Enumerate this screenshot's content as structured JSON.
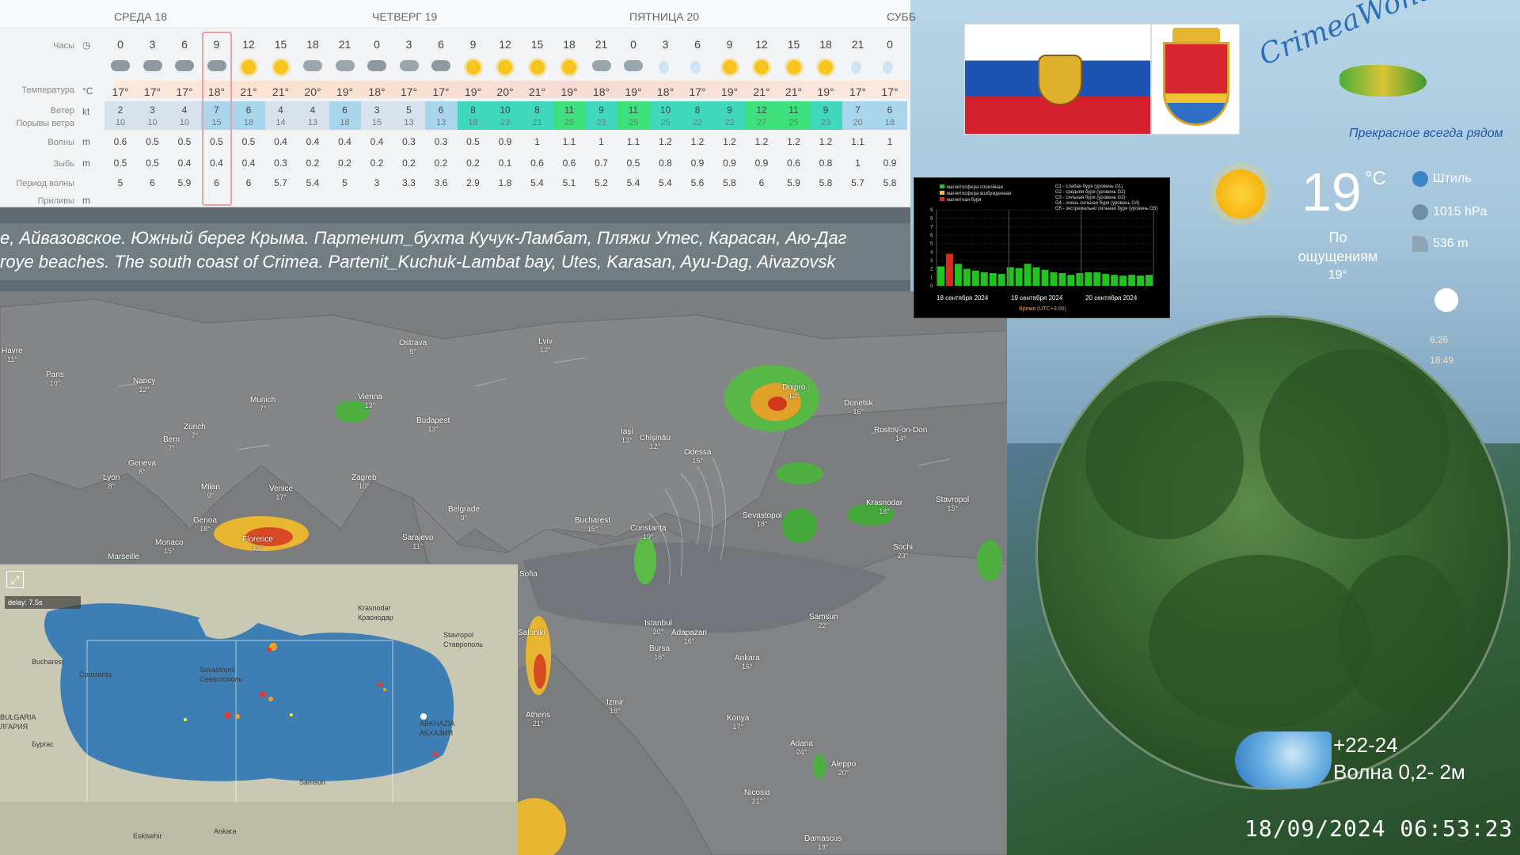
{
  "forecast": {
    "days": {
      "wed": "СРЕДА 18",
      "thu": "ЧЕТВЕРГ 19",
      "fri": "ПЯТНИЦА 20",
      "sat": "СУББ"
    },
    "labels": {
      "hours": "Часы",
      "temperature": "Температура",
      "wind": "Ветер",
      "gusts": "Порывы ветра",
      "waves": "Волны",
      "swell": "Зыбь",
      "wave_period": "Период волны",
      "tides": "Приливы"
    },
    "units": {
      "temperature": "°C",
      "wind": "kt",
      "waves": "m",
      "swell": "m",
      "tides": "m"
    },
    "hours": [
      "0",
      "3",
      "6",
      "9",
      "12",
      "15",
      "18",
      "21",
      "0",
      "3",
      "6",
      "9",
      "12",
      "15",
      "18",
      "21",
      "0",
      "3",
      "6",
      "9",
      "12",
      "15",
      "18",
      "21",
      "0"
    ],
    "sky": [
      "rain",
      "rain",
      "rain",
      "rain",
      "sun",
      "sun",
      "cloud",
      "cloud",
      "rain",
      "cloud",
      "rain",
      "sun",
      "sun",
      "sun",
      "sun",
      "cloud",
      "cloud",
      "moon",
      "moon",
      "sun",
      "sun",
      "sun",
      "sun",
      "moon",
      "moon"
    ],
    "temperature": [
      "17°",
      "17°",
      "17°",
      "18°",
      "21°",
      "21°",
      "20°",
      "19°",
      "18°",
      "17°",
      "17°",
      "19°",
      "20°",
      "21°",
      "19°",
      "18°",
      "19°",
      "18°",
      "17°",
      "19°",
      "21°",
      "21°",
      "19°",
      "17°",
      "17°"
    ],
    "wind": [
      "2",
      "3",
      "4",
      "7",
      "6",
      "4",
      "4",
      "6",
      "3",
      "5",
      "6",
      "8",
      "10",
      "8",
      "11",
      "9",
      "11",
      "10",
      "8",
      "9",
      "12",
      "11",
      "9",
      "7",
      "6"
    ],
    "gusts": [
      "10",
      "10",
      "10",
      "15",
      "18",
      "14",
      "13",
      "18",
      "15",
      "13",
      "13",
      "18",
      "23",
      "21",
      "25",
      "23",
      "25",
      "25",
      "22",
      "22",
      "27",
      "25",
      "23",
      "20",
      "18"
    ],
    "waves": [
      "0.6",
      "0.5",
      "0.5",
      "0.5",
      "0.5",
      "0.4",
      "0.4",
      "0.4",
      "0.4",
      "0.3",
      "0.3",
      "0.5",
      "0.9",
      "1",
      "1.1",
      "1",
      "1.1",
      "1.2",
      "1.2",
      "1.2",
      "1.2",
      "1.2",
      "1.2",
      "1.1",
      "1"
    ],
    "swell": [
      "0.5",
      "0.5",
      "0.4",
      "0.4",
      "0.4",
      "0.3",
      "0.2",
      "0.2",
      "0.2",
      "0.2",
      "0.2",
      "0.2",
      "0.1",
      "0.6",
      "0.6",
      "0.7",
      "0.5",
      "0.8",
      "0.9",
      "0.9",
      "0.9",
      "0.6",
      "0.8",
      "1",
      "0.9"
    ],
    "wave_period": [
      "5",
      "6",
      "5.9",
      "6",
      "6",
      "5.7",
      "5.4",
      "5",
      "3",
      "3.3",
      "3.6",
      "2.9",
      "1.8",
      "5.4",
      "5.1",
      "5.2",
      "5.4",
      "5.4",
      "5.6",
      "5.8",
      "6",
      "5.9",
      "5.8",
      "5.7",
      "5.8"
    ]
  },
  "ticker": {
    "line_ru": "е, Айвазовское.     Южный берег Крыма. Партенит_бухта Кучук-Ламбат, Пляжи Утес,   Карасан, Аю-Даг",
    "line_en": "roye beaches.      The south coast of Crimea. Partenit_Kuchuk-Lambat bay, Utes, Karasan, Ayu-Dag, Aivazovsk"
  },
  "map_cities": [
    {
      "name": "Havre",
      "t": "11°"
    },
    {
      "name": "Paris",
      "t": "10°"
    },
    {
      "name": "Nancy",
      "t": "12°"
    },
    {
      "name": "Ostrava",
      "t": "8°"
    },
    {
      "name": "Lviv",
      "t": "12°"
    },
    {
      "name": "Vienna",
      "t": "13°"
    },
    {
      "name": "Munich",
      "t": "7°"
    },
    {
      "name": "Zürich",
      "t": "7°"
    },
    {
      "name": "Bern",
      "t": "7°"
    },
    {
      "name": "Budapest",
      "t": "13°"
    },
    {
      "name": "Geneva",
      "t": "8°"
    },
    {
      "name": "Lyon",
      "t": "8°"
    },
    {
      "name": "Milan",
      "t": "9°"
    },
    {
      "name": "Venice",
      "t": "17°"
    },
    {
      "name": "Zagreb",
      "t": "10°"
    },
    {
      "name": "Iași",
      "t": "13°"
    },
    {
      "name": "Chișinău",
      "t": "12°"
    },
    {
      "name": "Odessa",
      "t": "15°"
    },
    {
      "name": "Dnipro",
      "t": "12°"
    },
    {
      "name": "Donetsk",
      "t": "16°"
    },
    {
      "name": "Rostov-on-Don",
      "t": "14°"
    },
    {
      "name": "Genoa",
      "t": "18°"
    },
    {
      "name": "Monaco",
      "t": "15°"
    },
    {
      "name": "Florence",
      "t": "13°"
    },
    {
      "name": "Marseille",
      "t": ""
    },
    {
      "name": "Belgrade",
      "t": "9°"
    },
    {
      "name": "Sarajevo",
      "t": "11°"
    },
    {
      "name": "Bucharest",
      "t": "15°"
    },
    {
      "name": "Constanța",
      "t": "19°"
    },
    {
      "name": "Sevastopol",
      "t": "18°"
    },
    {
      "name": "Krasnodar",
      "t": "18°"
    },
    {
      "name": "Stavropol",
      "t": "15°"
    },
    {
      "name": "Sochi",
      "t": "23°"
    },
    {
      "name": "Sofia",
      "t": ""
    },
    {
      "name": "Istanbul",
      "t": "20°"
    },
    {
      "name": "Adapazari",
      "t": "16°"
    },
    {
      "name": "Bursa",
      "t": "16°"
    },
    {
      "name": "Samsun",
      "t": "22°"
    },
    {
      "name": "Ankara",
      "t": "16°"
    },
    {
      "name": "Athens",
      "t": "21°"
    },
    {
      "name": "Izmir",
      "t": "18°"
    },
    {
      "name": "Konya",
      "t": "17°"
    },
    {
      "name": "Adana",
      "t": "24°"
    },
    {
      "name": "Aleppo",
      "t": "20°"
    },
    {
      "name": "Nicosia",
      "t": "21°"
    },
    {
      "name": "Damascus",
      "t": "18°"
    },
    {
      "name": "Saloniki",
      "t": ""
    }
  ],
  "blacksea": {
    "delay": "delay: 7.5s",
    "labels": [
      "Bucharest",
      "Constanța",
      "Sevastopol",
      "Севастополь",
      "Krasnodar",
      "Краснодар",
      "Stavropol",
      "Ставрополь",
      "ABKHAZIA",
      "АБХАЗИЯ",
      "Samsun",
      "ЛГАРИЯ",
      "BULGARIA",
      "Бургас",
      "Eskisehir",
      "Ankara"
    ]
  },
  "kp_chart": {
    "legend_left": [
      "магнитосфера спокойная",
      "магнитосфера возбужденная",
      "магнитная буря"
    ],
    "legend_right": [
      "G1 - слабая буря (уровень G1)",
      "G2 - средняя буря (уровень G2)",
      "G3 - сильная буря (уровень G3)",
      "G4 - очень сильная буря (уровень G4)",
      "G5 - экстремально сильная буря (уровень G5)"
    ],
    "dates": [
      "18 сентября 2024",
      "19 сентября 2024",
      "20 сентября 2024"
    ],
    "time_label": "Время (UTC+3:00)",
    "values": [
      2.3,
      3.8,
      2.6,
      2.0,
      1.8,
      1.6,
      1.5,
      1.4,
      2.2,
      2.1,
      2.6,
      2.2,
      1.9,
      1.6,
      1.5,
      1.3,
      1.5,
      1.6,
      1.6,
      1.4,
      1.3,
      1.2,
      1.3,
      1.2,
      1.3
    ],
    "colors": {
      "quiet": "#22c21f",
      "storm": "#e0261f"
    }
  },
  "logo": {
    "title": "CrimeaWonderland",
    "tagline": "Прекрасное всегда рядом"
  },
  "current": {
    "temp": "19",
    "unit": "°C",
    "feels_label": "По ощущениям",
    "feels_value": "19°",
    "wind": "Штиль",
    "pressure": "1015 hPa",
    "altitude": "536 m",
    "sunrise": "6:26",
    "sunset": "18:49"
  },
  "sea": {
    "water_temp": "+22-24",
    "wave": "Волна  0,2- 2м"
  },
  "timestamp": "18/09/2024 06:53:23"
}
